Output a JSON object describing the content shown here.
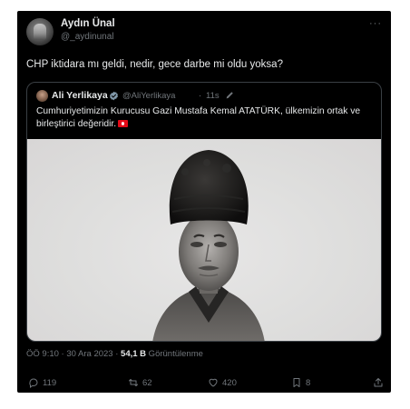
{
  "author": {
    "name": "Aydın Ünal",
    "handle": "@_aydinunal"
  },
  "menu": {
    "more_label": "···"
  },
  "tweet": {
    "text": "CHP iktidara mı geldi, nedir, gece darbe mi oldu yoksa?"
  },
  "quote": {
    "name": "Ali Yerlikaya",
    "handle": "@AliYerlikaya",
    "separator": "·",
    "time": "11s",
    "text": "Cumhuriyetimizin Kurucusu Gazi Mustafa Kemal ATATÜRK, ülkemizin ortak ve birleştirici değeridir.",
    "flag_icon": "turkey-flag-icon",
    "badge_color": "#829aab"
  },
  "meta": {
    "time": "ÖÖ 9:10 · 30 Ara 2023 · ",
    "views_count": "54,1 B",
    "views_label": " Görüntülenme"
  },
  "actions": {
    "reply_count": "119",
    "retweet_count": "62",
    "like_count": "420",
    "bookmark_count": "8"
  },
  "colors": {
    "background": "#000000",
    "text": "#e7e9ea",
    "secondary": "#71767b",
    "border": "#3a3f44"
  }
}
